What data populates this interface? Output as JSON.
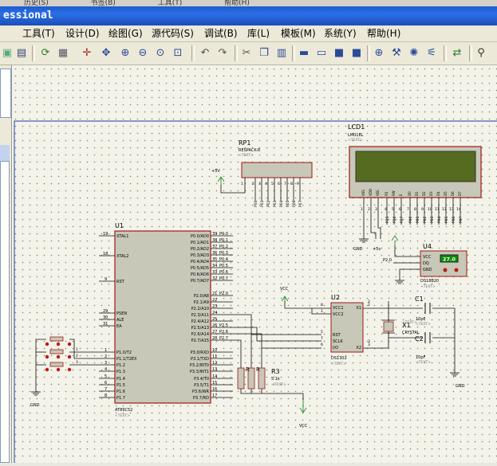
{
  "window": {
    "top_menu": [
      "历史(S)",
      "书签(B)",
      "工具(T)",
      "帮助(H)"
    ],
    "title": "essional"
  },
  "menu": {
    "items": [
      "工具(T)",
      "设计(D)",
      "绘图(G)",
      "源代码(S)",
      "调试(B)",
      "库(L)",
      "模板(M)",
      "系统(Y)",
      "帮助(H)"
    ]
  },
  "schematic": {
    "lcd": {
      "ref": "LCD1",
      "part": "LM016L",
      "text": "<TEXT>",
      "pins": [
        "VSS",
        "VDD",
        "VEE",
        "RS",
        "RW",
        "E",
        "D0",
        "D1",
        "D2",
        "D3",
        "D4",
        "D5",
        "D6",
        "D7"
      ]
    },
    "rp1": {
      "ref": "RP1",
      "part": "RESPACK-8",
      "text": "<TEXT>",
      "pins": [
        "P00",
        "P01",
        "P02",
        "P03",
        "P04",
        "P05",
        "P06",
        "P07"
      ],
      "plus5v": "+5V"
    },
    "u1": {
      "ref": "U1",
      "part": "AT89C52",
      "text": "<TEXT>",
      "left_pins": [
        {
          "num": "19",
          "name": "XTAL1"
        },
        {
          "num": "18",
          "name": "XTAL2"
        },
        {
          "num": "9",
          "name": "RST"
        },
        {
          "num": "29",
          "name": "PSEN"
        },
        {
          "num": "30",
          "name": "ALE"
        },
        {
          "num": "31",
          "name": "EA"
        },
        {
          "num": "1",
          "name": "P1.0/T2"
        },
        {
          "num": "2",
          "name": "P1.1/T2EX"
        },
        {
          "num": "3",
          "name": "P1.2"
        },
        {
          "num": "4",
          "name": "P1.3"
        },
        {
          "num": "5",
          "name": "P1.4"
        },
        {
          "num": "6",
          "name": "P1.5"
        },
        {
          "num": "7",
          "name": "P1.6"
        },
        {
          "num": "8",
          "name": "P1.7"
        }
      ],
      "right_pins": [
        {
          "num": "39",
          "name": "P0.0/AD0",
          "net": "P0.0"
        },
        {
          "num": "38",
          "name": "P0.1/AD1",
          "net": "P0.1"
        },
        {
          "num": "37",
          "name": "P0.2/AD2",
          "net": "P0.2"
        },
        {
          "num": "36",
          "name": "P0.3/AD3",
          "net": "P0.3"
        },
        {
          "num": "35",
          "name": "P0.4/AD4",
          "net": "P0.4"
        },
        {
          "num": "34",
          "name": "P0.5/AD5",
          "net": "P0.5"
        },
        {
          "num": "33",
          "name": "P0.6/AD6",
          "net": "P0.6"
        },
        {
          "num": "32",
          "name": "P0.7/AD7",
          "net": "P0.7"
        },
        {
          "num": "21",
          "name": "P2.0/A8",
          "net": "P2.0"
        },
        {
          "num": "22",
          "name": "P2.1/A9",
          "net": ""
        },
        {
          "num": "23",
          "name": "P2.2/A10",
          "net": ""
        },
        {
          "num": "24",
          "name": "P2.3/A11",
          "net": ""
        },
        {
          "num": "25",
          "name": "P2.4/A12",
          "net": ""
        },
        {
          "num": "26",
          "name": "P2.5/A13",
          "net": "P2.5"
        },
        {
          "num": "27",
          "name": "P2.6/A14",
          "net": "P2.6"
        },
        {
          "num": "28",
          "name": "P2.7/A15",
          "net": "P2.7"
        },
        {
          "num": "10",
          "name": "P3.0/RXD",
          "net": ""
        },
        {
          "num": "11",
          "name": "P3.1/TXD",
          "net": ""
        },
        {
          "num": "12",
          "name": "P3.2/INT0",
          "net": ""
        },
        {
          "num": "13",
          "name": "P3.3/INT1",
          "net": ""
        },
        {
          "num": "14",
          "name": "P3.4/T0",
          "net": ""
        },
        {
          "num": "15",
          "name": "P3.5/T1",
          "net": ""
        },
        {
          "num": "16",
          "name": "P3.6/WR",
          "net": ""
        },
        {
          "num": "17",
          "name": "P3.7/RD",
          "net": ""
        }
      ]
    },
    "u2": {
      "ref": "U2",
      "part": "DS1302",
      "text": "<TEXT>",
      "pins": [
        {
          "num": "8",
          "name": "VCC1"
        },
        {
          "num": "1",
          "name": "VCC2"
        },
        {
          "num": "5",
          "name": "RST"
        },
        {
          "num": "7",
          "name": "SCLK"
        },
        {
          "num": "6",
          "name": "I/O"
        }
      ],
      "right_pins": [
        {
          "num": "2",
          "name": "X1"
        },
        {
          "num": "3",
          "name": "X2"
        }
      ]
    },
    "u4": {
      "ref": "U4",
      "part": "DS18B20",
      "text": "<TEXT>",
      "display": "27.0",
      "pins": [
        "VCC",
        "DQ",
        "GND"
      ]
    },
    "x1": {
      "ref": "X1",
      "part": "CRYSTAL",
      "text": "<TEXT>"
    },
    "c1": {
      "ref": "C1",
      "value": "10pF",
      "text": "<TEXT>"
    },
    "c2": {
      "ref": "C2",
      "value": "10pF",
      "text": "<TEXT>"
    },
    "r3": {
      "ref": "R3",
      "value": "5.1k",
      "text": "<TEXT>"
    },
    "labels": {
      "vcc": "VCC",
      "gnd": "GND",
      "plus5v": "+5v",
      "p20": "P2.0",
      "lcd_nets": [
        "P25",
        "P26",
        "P27",
        "P00",
        "P01",
        "P02",
        "P03",
        "P04",
        "P05",
        "P06",
        "P07"
      ],
      "lcd_power_nums": [
        "1",
        "2",
        "3"
      ],
      "lcd_ctrl_nums": [
        "4",
        "5",
        "6"
      ],
      "lcd_data_nums": [
        "7",
        "8",
        "9",
        "10",
        "11",
        "12",
        "13",
        "14"
      ],
      "rp_num": "1",
      "rp_pin_nums": [
        "2",
        "3",
        "4",
        "5",
        "6",
        "7",
        "8",
        "9"
      ],
      "u2_pin_nums": [
        "8",
        "1",
        "5",
        "7",
        "6",
        "2",
        "3"
      ],
      "cap_nums": [
        "2",
        "3"
      ],
      "p1_nums": [
        "1",
        "2",
        "3"
      ]
    }
  }
}
